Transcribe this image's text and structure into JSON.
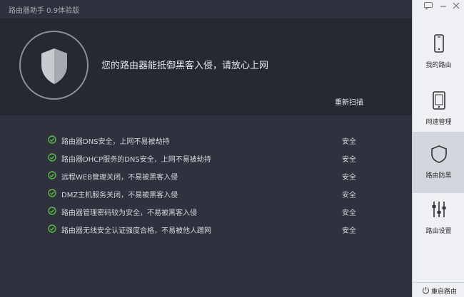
{
  "app": {
    "title": "路由器助手 0.9体验版"
  },
  "header": {
    "message": "您的路由器能抵御黑客入侵，请放心上网",
    "rescan_label": "重新扫描"
  },
  "checks": [
    {
      "text": "路由器DNS安全，上网不易被劫持",
      "status": "安全"
    },
    {
      "text": "路由器DHCP服务的DNS安全，上网不易被劫持",
      "status": "安全"
    },
    {
      "text": "远程WEB管理关闭，不易被黑客入侵",
      "status": "安全"
    },
    {
      "text": "DMZ主机服务关闭，不易被黑客入侵",
      "status": "安全"
    },
    {
      "text": "路由器管理密码较为安全，不易被黑客入侵",
      "status": "安全"
    },
    {
      "text": "路由器无线安全认证强度合格，不易被他人蹭网",
      "status": "安全"
    }
  ],
  "sidebar": {
    "items": [
      {
        "label": "我的路由",
        "icon": "phone-icon"
      },
      {
        "label": "网速管理",
        "icon": "tablet-icon"
      },
      {
        "label": "路由防黑",
        "icon": "shield-icon",
        "active": true
      },
      {
        "label": "路由设置",
        "icon": "sliders-icon"
      }
    ],
    "reboot_label": "重启路由"
  },
  "colors": {
    "accent_green": "#58b947",
    "sidebar_bg": "#eef0f3",
    "active_bg": "#d3d6dc",
    "main_bg": "#2f313c"
  }
}
